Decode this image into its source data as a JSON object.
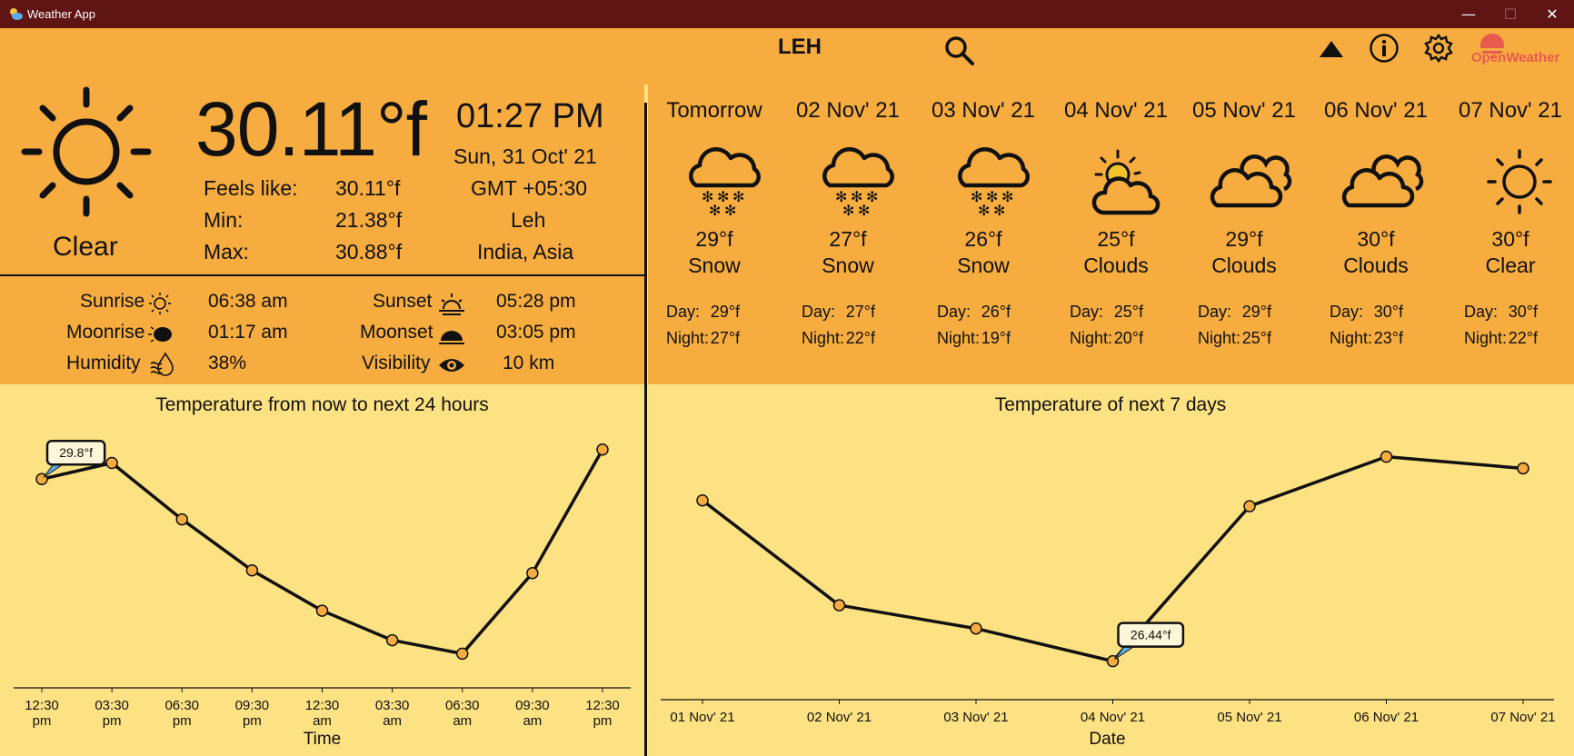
{
  "window": {
    "title": "Weather App",
    "minimize": "—",
    "maximize": "☐",
    "close": "✕"
  },
  "header": {
    "city": "LEH",
    "search_icon": "search-icon",
    "up_icon": "triangle-up-icon",
    "info_icon": "info-icon",
    "settings_icon": "gear-icon",
    "logo_text": "OpenWeather"
  },
  "current": {
    "icon": "sun-icon",
    "description": "Clear",
    "temperature": "30.11°f",
    "time": "01:27 PM",
    "date": "Sun, 31 Oct' 21",
    "timezone": "GMT +05:30",
    "city": "Leh",
    "region": "India, Asia",
    "feels_like_label": "Feels like:",
    "feels_like": "30.11°f",
    "min_label": "Min:",
    "min": "21.38°f",
    "max_label": "Max:",
    "max": "30.88°f"
  },
  "details": {
    "sunrise_label": "Sunrise",
    "sunrise": "06:38 am",
    "sunset_label": "Sunset",
    "sunset": "05:28 pm",
    "moonrise_label": "Moonrise",
    "moonrise": "01:17 am",
    "moonset_label": "Moonset",
    "moonset": "03:05 pm",
    "humidity_label": "Humidity",
    "humidity": "38%",
    "visibility_label": "Visibility",
    "visibility": "10 km"
  },
  "forecast": [
    {
      "date": "Tomorrow",
      "icon": "snow-cloud-icon",
      "temp": "29°f",
      "desc": "Snow",
      "day": "29°f",
      "night": "27°f"
    },
    {
      "date": "02 Nov' 21",
      "icon": "snow-cloud-icon",
      "temp": "27°f",
      "desc": "Snow",
      "day": "27°f",
      "night": "22°f"
    },
    {
      "date": "03 Nov' 21",
      "icon": "snow-cloud-icon",
      "temp": "26°f",
      "desc": "Snow",
      "day": "26°f",
      "night": "19°f"
    },
    {
      "date": "04 Nov' 21",
      "icon": "sun-behind-cloud-icon",
      "temp": "25°f",
      "desc": "Clouds",
      "day": "25°f",
      "night": "20°f"
    },
    {
      "date": "05 Nov' 21",
      "icon": "clouds-icon",
      "temp": "29°f",
      "desc": "Clouds",
      "day": "29°f",
      "night": "25°f"
    },
    {
      "date": "06 Nov' 21",
      "icon": "clouds-icon",
      "temp": "30°f",
      "desc": "Clouds",
      "day": "30°f",
      "night": "23°f"
    },
    {
      "date": "07 Nov' 21",
      "icon": "sun-icon",
      "temp": "30°f",
      "desc": "Clear",
      "day": "30°f",
      "night": "22°f"
    }
  ],
  "day_label": "Day:",
  "night_label": "Night:",
  "colors": {
    "panel": "#f6ac3f",
    "chart_bg": "#fde283",
    "titlebar": "#5e1514",
    "marker": "#f6ac3f"
  },
  "chart_data": [
    {
      "type": "line",
      "title": "Temperature from now to next 24 hours",
      "xlabel": "Time",
      "ylabel": "",
      "categories": [
        "12:30\npm",
        "03:30\npm",
        "06:30\npm",
        "09:30\npm",
        "12:30\nam",
        "03:30\nam",
        "06:30\nam",
        "09:30\nam",
        "12:30\npm"
      ],
      "values": [
        29.8,
        30.4,
        28.3,
        26.4,
        24.9,
        23.8,
        23.3,
        26.3,
        30.9
      ],
      "ylim": [
        22.5,
        31.5
      ],
      "annotation": {
        "index": 0,
        "text": "29.8°f"
      },
      "grid": false
    },
    {
      "type": "line",
      "title": "Temperature of next 7 days",
      "xlabel": "Date",
      "ylabel": "",
      "categories": [
        "01 Nov' 21",
        "02 Nov' 21",
        "03 Nov' 21",
        "04 Nov' 21",
        "05 Nov' 21",
        "06 Nov' 21",
        "07 Nov' 21"
      ],
      "values": [
        29.2,
        27.4,
        27.0,
        26.44,
        29.1,
        29.95,
        29.75
      ],
      "ylim": [
        26.2,
        30.35
      ],
      "annotation": {
        "index": 3,
        "text": "26.44°f"
      },
      "grid": false
    }
  ]
}
